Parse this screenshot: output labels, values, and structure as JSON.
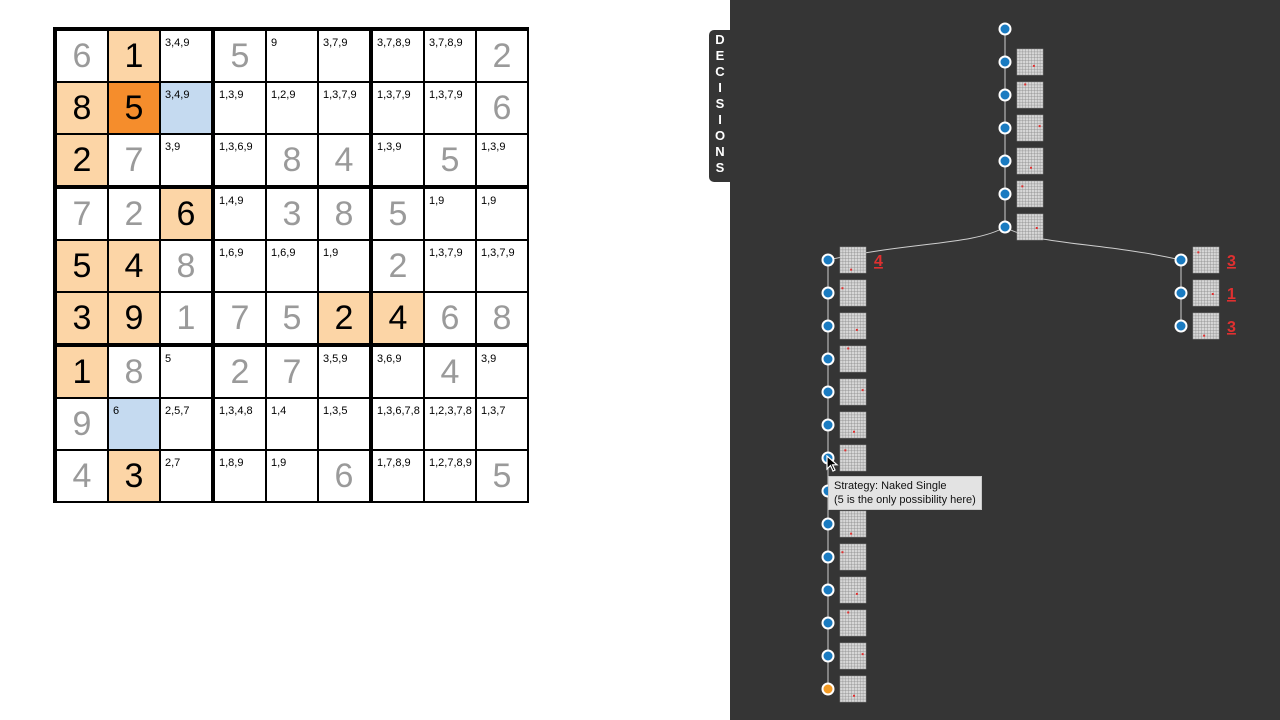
{
  "board": {
    "cells": [
      [
        {
          "v": "6",
          "t": "given"
        },
        {
          "v": "1",
          "t": "placed",
          "hl": "light"
        },
        {
          "c": "3,4,9"
        },
        {
          "v": "5",
          "t": "given"
        },
        {
          "c": "9"
        },
        {
          "c": "3,7,9"
        },
        {
          "c": "3,7,8,9"
        },
        {
          "c": "3,7,8,9"
        },
        {
          "v": "2",
          "t": "given"
        }
      ],
      [
        {
          "v": "8",
          "t": "placed",
          "hl": "light"
        },
        {
          "v": "5",
          "t": "placed",
          "hl": "dark"
        },
        {
          "c": "3,4,9",
          "hl": "blue"
        },
        {
          "c": "1,3,9"
        },
        {
          "c": "1,2,9"
        },
        {
          "c": "1,3,7,9"
        },
        {
          "c": "1,3,7,9"
        },
        {
          "c": "1,3,7,9"
        },
        {
          "v": "6",
          "t": "given"
        }
      ],
      [
        {
          "v": "2",
          "t": "placed",
          "hl": "light"
        },
        {
          "v": "7",
          "t": "given"
        },
        {
          "c": "3,9"
        },
        {
          "c": "1,3,6,9"
        },
        {
          "v": "8",
          "t": "given"
        },
        {
          "v": "4",
          "t": "given"
        },
        {
          "c": "1,3,9"
        },
        {
          "v": "5",
          "t": "given"
        },
        {
          "c": "1,3,9"
        }
      ],
      [
        {
          "v": "7",
          "t": "given"
        },
        {
          "v": "2",
          "t": "given"
        },
        {
          "v": "6",
          "t": "placed",
          "hl": "light"
        },
        {
          "c": "1,4,9"
        },
        {
          "v": "3",
          "t": "given"
        },
        {
          "v": "8",
          "t": "given"
        },
        {
          "v": "5",
          "t": "given"
        },
        {
          "c": "1,9"
        },
        {
          "c": "1,9"
        }
      ],
      [
        {
          "v": "5",
          "t": "placed",
          "hl": "light"
        },
        {
          "v": "4",
          "t": "placed",
          "hl": "light"
        },
        {
          "v": "8",
          "t": "given"
        },
        {
          "c": "1,6,9"
        },
        {
          "c": "1,6,9"
        },
        {
          "c": "1,9"
        },
        {
          "v": "2",
          "t": "given"
        },
        {
          "c": "1,3,7,9"
        },
        {
          "c": "1,3,7,9"
        }
      ],
      [
        {
          "v": "3",
          "t": "placed",
          "hl": "light"
        },
        {
          "v": "9",
          "t": "placed",
          "hl": "light"
        },
        {
          "v": "1",
          "t": "given"
        },
        {
          "v": "7",
          "t": "given"
        },
        {
          "v": "5",
          "t": "given"
        },
        {
          "v": "2",
          "t": "placed",
          "hl": "light"
        },
        {
          "v": "4",
          "t": "placed",
          "hl": "light"
        },
        {
          "v": "6",
          "t": "given"
        },
        {
          "v": "8",
          "t": "given"
        }
      ],
      [
        {
          "v": "1",
          "t": "placed",
          "hl": "light"
        },
        {
          "v": "8",
          "t": "given"
        },
        {
          "c": "5"
        },
        {
          "v": "2",
          "t": "given"
        },
        {
          "v": "7",
          "t": "given"
        },
        {
          "c": "3,5,9"
        },
        {
          "c": "3,6,9"
        },
        {
          "v": "4",
          "t": "given"
        },
        {
          "c": "3,9"
        }
      ],
      [
        {
          "v": "9",
          "t": "given"
        },
        {
          "c": "6",
          "hl": "blue"
        },
        {
          "c": "2,5,7"
        },
        {
          "c": "1,3,4,8"
        },
        {
          "c": "1,4"
        },
        {
          "c": "1,3,5"
        },
        {
          "c": "1,3,6,7,8"
        },
        {
          "c": "1,2,3,7,8"
        },
        {
          "c": "1,3,7"
        }
      ],
      [
        {
          "v": "4",
          "t": "given"
        },
        {
          "v": "3",
          "t": "placed",
          "hl": "light"
        },
        {
          "c": "2,7"
        },
        {
          "c": "1,8,9"
        },
        {
          "c": "1,9"
        },
        {
          "v": "6",
          "t": "given"
        },
        {
          "c": "1,7,8,9"
        },
        {
          "c": "1,2,7,8,9"
        },
        {
          "v": "5",
          "t": "given"
        }
      ]
    ]
  },
  "colors": {
    "highlight_light": "#fcd5a6",
    "highlight_dark": "#f58d2c",
    "highlight_blue": "#c5daf0",
    "panel_bg": "#353535",
    "node_blue": "#1a7bc1",
    "node_orange": "#f39b25",
    "branch_label": "#e03030"
  },
  "decisions_tab": {
    "label": "DECISIONS"
  },
  "tree": {
    "branch_labels": [
      "4",
      "3",
      "1",
      "3"
    ]
  },
  "tooltip": {
    "line1": "Strategy: Naked Single",
    "line2": "(5 is the only possibility here)"
  }
}
